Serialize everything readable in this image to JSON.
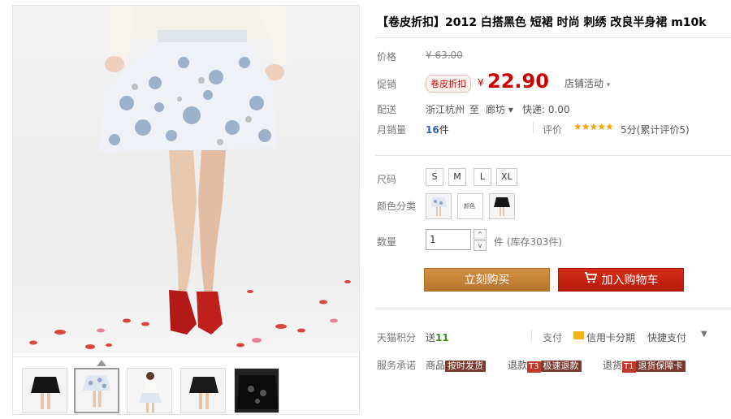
{
  "product": {
    "title": "【卷皮折扣】2012 白搭黑色 短裙 时尚 刺绣 改良半身裙 m10k"
  },
  "price": {
    "orig_label": "价格",
    "orig_value": "¥ 63.00",
    "promo_label": "促销",
    "promo_badge": "卷皮折扣",
    "currency": "¥",
    "promo_value": "22.90",
    "shop_promo": "店铺活动"
  },
  "shipping": {
    "label": "配送",
    "from": "浙江杭州",
    "to_word": "至",
    "dest": "廊坊 ▾",
    "fee": "快递: 0.00"
  },
  "sales": {
    "label": "月销量",
    "count": "16",
    "unit": "件",
    "review_label": "评价",
    "stars": "★★★★★",
    "review_text": "5分(累计评价5)"
  },
  "size": {
    "label": "尺码",
    "options": [
      "S",
      "M",
      "L",
      "XL"
    ]
  },
  "color": {
    "label": "颜色分类",
    "mid_swatch_text": "颜色"
  },
  "quantity": {
    "label": "数量",
    "value": "1",
    "up": "^",
    "down": "v",
    "stock": "件 (库存303件)"
  },
  "buttons": {
    "buy": "立刻购买",
    "cart": "加入购物车"
  },
  "points": {
    "label": "天猫积分",
    "prefix": "送",
    "value": "11"
  },
  "payment": {
    "label": "支付",
    "card": "信用卡分期",
    "fast": "快捷支付",
    "caret": "▼"
  },
  "service": {
    "label": "服务承诺",
    "item1_prefix": "商品",
    "item1_tag": "按时发货",
    "item2_prefix": "退款",
    "item2_code": "T3",
    "item2_tag": "极速退款",
    "item3_prefix": "退货",
    "item3_code": "T1",
    "item3_tag": "退货保障卡"
  },
  "colors": {
    "price_red": "#cc0000",
    "buy_btn": "#c9853a",
    "cart_btn": "#c42413",
    "link_blue": "#2b64b1"
  }
}
